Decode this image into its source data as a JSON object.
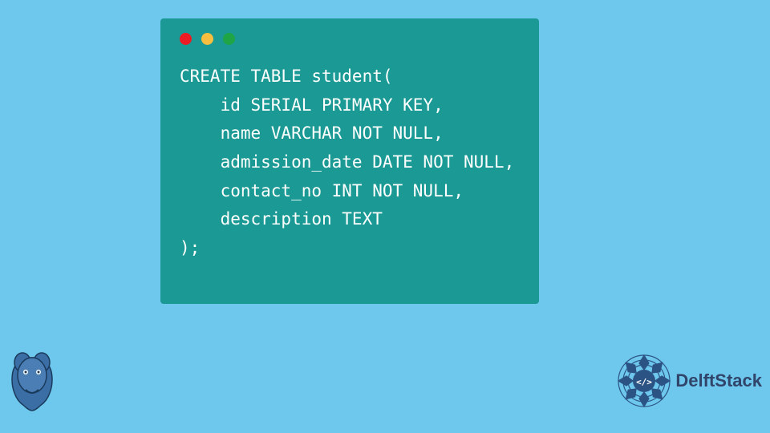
{
  "code": {
    "line1": "CREATE TABLE student(",
    "line2": "    id SERIAL PRIMARY KEY,",
    "line3": "    name VARCHAR NOT NULL,",
    "line4": "    admission_date DATE NOT NULL,",
    "line5": "    contact_no INT NOT NULL,",
    "line6": "    description TEXT",
    "line7": ");"
  },
  "brand": {
    "name": "DelftStack"
  },
  "colors": {
    "background": "#6ec8ed",
    "codeWindow": "#1b9a95",
    "codeText": "#ffffff",
    "brandText": "#31456a",
    "brandAccent": "#2b5384"
  }
}
